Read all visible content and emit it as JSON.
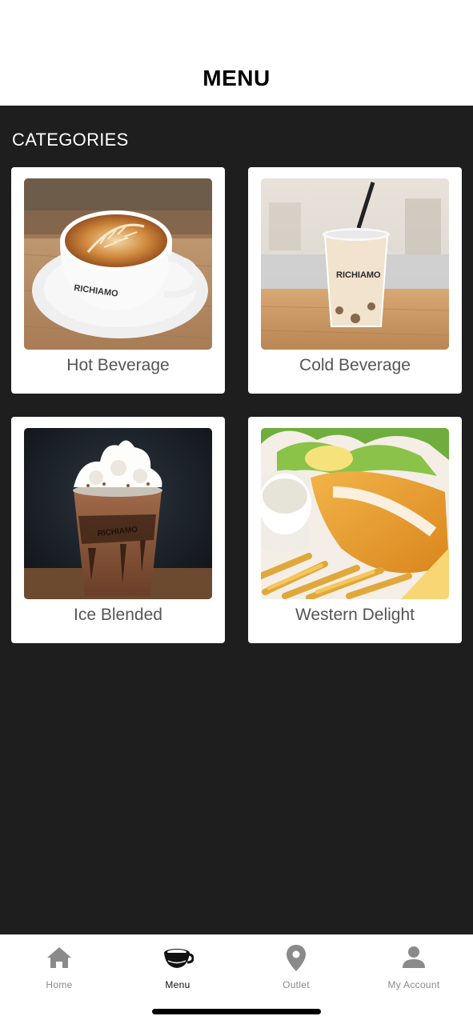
{
  "header": {
    "title": "MENU"
  },
  "section": {
    "title": "CATEGORIES"
  },
  "categories": [
    {
      "label": "Hot Beverage",
      "image": "latte-art-cup-photo"
    },
    {
      "label": "Cold Beverage",
      "image": "iced-latte-cup-photo"
    },
    {
      "label": "Ice Blended",
      "image": "chocolate-frappe-photo"
    },
    {
      "label": "Western Delight",
      "image": "fish-and-chips-photo"
    }
  ],
  "nav": {
    "items": [
      {
        "label": "Home",
        "icon": "home-icon",
        "active": false
      },
      {
        "label": "Menu",
        "icon": "coffee-cup-icon",
        "active": true
      },
      {
        "label": "Outlet",
        "icon": "location-pin-icon",
        "active": false
      },
      {
        "label": "My Account",
        "icon": "person-icon",
        "active": false
      }
    ]
  },
  "colors": {
    "background_dark": "#1e1e1e",
    "card": "#ffffff",
    "label": "#555555",
    "nav_inactive": "#8a8a8a",
    "nav_active": "#111111"
  }
}
